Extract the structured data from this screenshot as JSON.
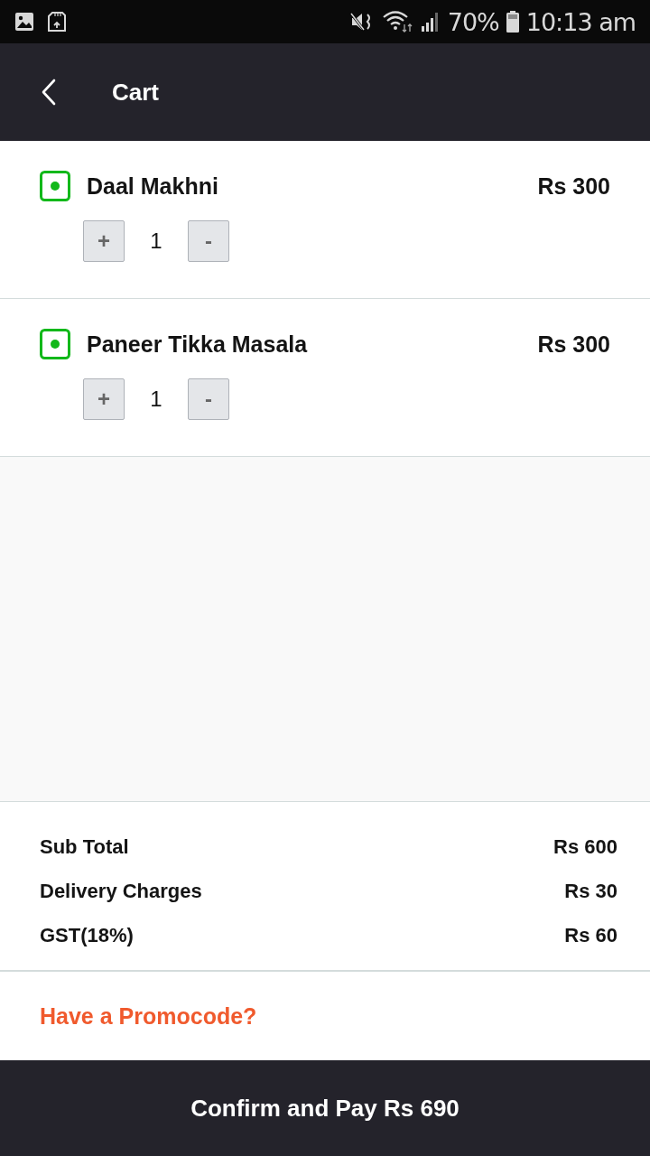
{
  "status_bar": {
    "battery": "70%",
    "time": "10:13 am"
  },
  "app_bar": {
    "title": "Cart"
  },
  "cart_items": [
    {
      "name": "Daal Makhni",
      "price": "Rs 300",
      "quantity": "1",
      "increase": "+",
      "decrease": "-"
    },
    {
      "name": "Paneer Tikka Masala",
      "price": "Rs 300",
      "quantity": "1",
      "increase": "+",
      "decrease": "-"
    }
  ],
  "summary": [
    {
      "label": "Sub Total",
      "value": "Rs 600"
    },
    {
      "label": "Delivery Charges",
      "value": "Rs 30"
    },
    {
      "label": "GST(18%)",
      "value": "Rs 60"
    }
  ],
  "promo_link": "Have a Promocode?",
  "pay_button": "Confirm and Pay Rs 690"
}
